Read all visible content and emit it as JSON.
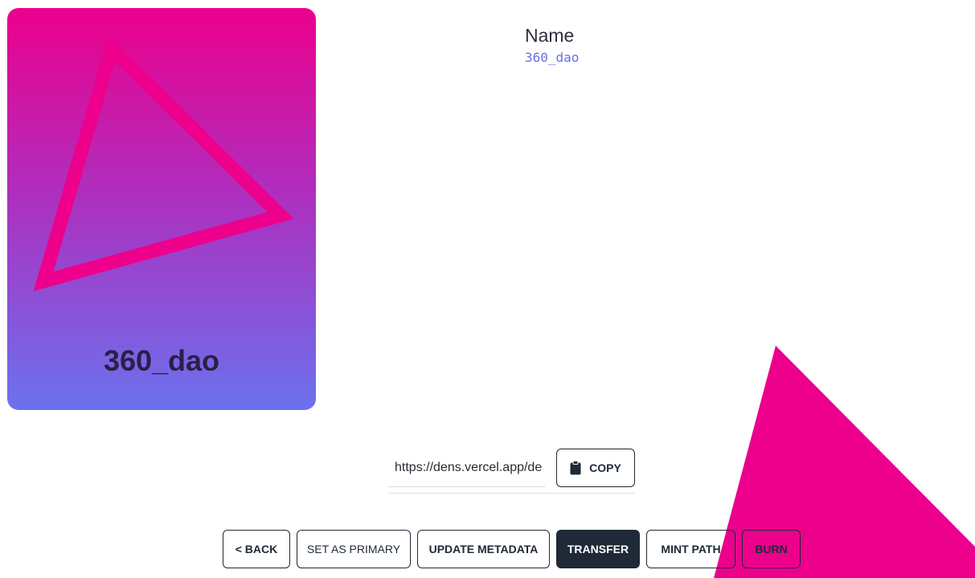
{
  "card": {
    "title": "360_dao",
    "gradient_top": "#ec008c",
    "gradient_bottom": "#6a72ee",
    "accent": "#ec008c"
  },
  "details": {
    "name_label": "Name",
    "name_value": "360_dao"
  },
  "share": {
    "url_value": "https://dens.vercel.app/de",
    "copy_icon": "clipboard-icon",
    "copy_label": "COPY"
  },
  "actions": {
    "back_label": "< BACK",
    "set_primary_label": "SET AS PRIMARY",
    "update_metadata_label": "UPDATE METADATA",
    "transfer_label": "TRANSFER",
    "mint_path_label": "MINT PATH",
    "burn_label": "BURN"
  },
  "colors": {
    "dark": "#1f2937",
    "accent": "#ec008c",
    "link": "#6b6fe0"
  }
}
